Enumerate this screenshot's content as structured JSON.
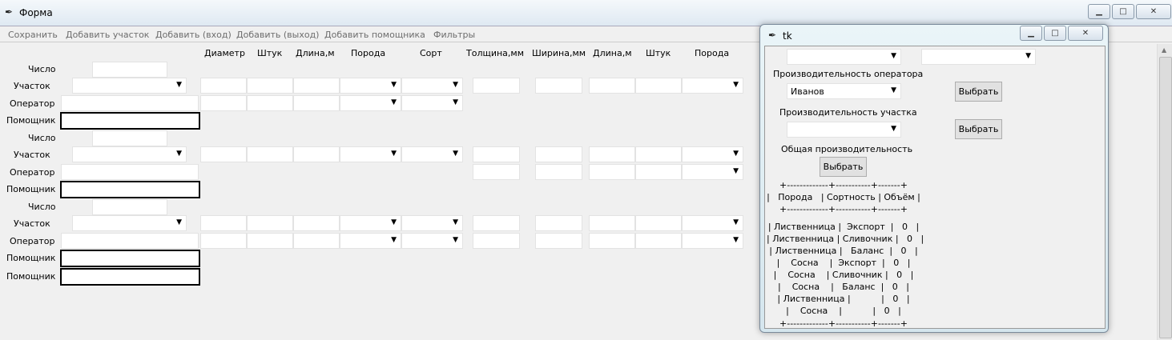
{
  "main_window": {
    "title": "Форма"
  },
  "menu": [
    "Сохранить",
    "Добавить участок",
    "Добавить (вход)",
    "Добавить (выход)",
    "Добавить помощника",
    "Фильтры"
  ],
  "column_headers": [
    "Диаметр",
    "Штук",
    "Длина,м",
    "Порода",
    "Сорт",
    "Толщина,мм",
    "Ширина,мм",
    "Длина,м",
    "Штук",
    "Порода"
  ],
  "labels": {
    "number": "Число",
    "section": "Участок",
    "operator": "Оператор",
    "helper": "Помощник"
  },
  "tk_window": {
    "title": "tk",
    "operator_perf_label": "Производительность оператора",
    "operator_value": "Иванов",
    "section_perf_label": "Производительность участка",
    "total_perf_label": "Общая производительность",
    "choose_label": "Выбрать",
    "table_lines": [
      "+-------------+-----------+-------+",
      "|   Порода   | Сортность | Объём |",
      "+-------------+-----------+-------+",
      "| Лиственница |  Экспорт  |   0   |",
      "| Лиственница | Сливочник |   0   |",
      "| Лиственница |   Баланс  |   0   |",
      "|    Сосна    |  Экспорт  |   0   |",
      "|    Сосна    | Сливочник |   0   |",
      "|    Сосна    |   Баланс  |   0   |",
      "| Лиственница |           |   0   |",
      "|    Сосна    |           |   0   |",
      "+-------------+-----------+-------+"
    ]
  }
}
